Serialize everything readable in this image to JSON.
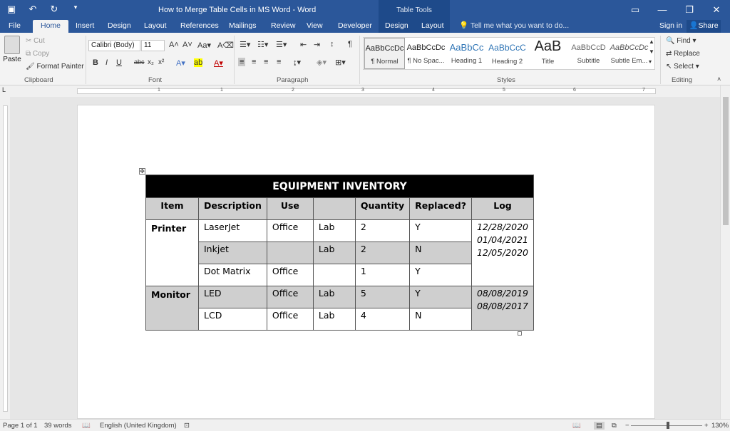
{
  "titlebar": {
    "doc_title": "How to Merge Table Cells in MS Word - Word",
    "context_group": "Table Tools"
  },
  "tabs": [
    "File",
    "Home",
    "Insert",
    "Design",
    "Layout",
    "References",
    "Mailings",
    "Review",
    "View",
    "Developer",
    "Design",
    "Layout"
  ],
  "tell_me": "Tell me what you want to do...",
  "sign_in": "Sign in",
  "share": "Share",
  "clipboard": {
    "paste": "Paste",
    "cut": "Cut",
    "copy": "Copy",
    "format_painter": "Format Painter",
    "label": "Clipboard"
  },
  "font": {
    "name": "Calibri (Body)",
    "size": "11",
    "label": "Font"
  },
  "paragraph": {
    "label": "Paragraph"
  },
  "styles": {
    "label": "Styles",
    "items": [
      {
        "sample": "AaBbCcDc",
        "name": "¶ Normal"
      },
      {
        "sample": "AaBbCcDc",
        "name": "¶ No Spac..."
      },
      {
        "sample": "AaBbCc",
        "name": "Heading 1"
      },
      {
        "sample": "AaBbCcC",
        "name": "Heading 2"
      },
      {
        "sample": "AaB",
        "name": "Title"
      },
      {
        "sample": "AaBbCcD",
        "name": "Subtitle"
      },
      {
        "sample": "AaBbCcDc",
        "name": "Subtle Em..."
      }
    ]
  },
  "editing": {
    "find": "Find",
    "replace": "Replace",
    "select": "Select",
    "label": "Editing"
  },
  "ruler_numbers": [
    "1",
    "1",
    "2",
    "3",
    "4",
    "5",
    "6",
    "7"
  ],
  "table": {
    "title": "EQUIPMENT INVENTORY",
    "headers": [
      "Item",
      "Description",
      "Use",
      "",
      "Quantity",
      "Replaced?",
      "Log"
    ],
    "printer": {
      "item": "Printer",
      "rows": [
        {
          "desc": "LaserJet",
          "use": "Office",
          "loc": "Lab",
          "qty": "2",
          "rep": "Y"
        },
        {
          "desc": "Inkjet",
          "use": "",
          "loc": "Lab",
          "qty": "2",
          "rep": "N"
        },
        {
          "desc": "Dot Matrix",
          "use": "Office",
          "loc": "",
          "qty": "1",
          "rep": "Y"
        }
      ],
      "log": [
        "12/28/2020",
        "01/04/2021",
        "12/05/2020"
      ]
    },
    "monitor": {
      "item": "Monitor",
      "rows": [
        {
          "desc": "LED",
          "use": "Office",
          "loc": "Lab",
          "qty": "5",
          "rep": "Y"
        },
        {
          "desc": "LCD",
          "use": "Office",
          "loc": "Lab",
          "qty": "4",
          "rep": "N"
        }
      ],
      "log": [
        "08/08/2019",
        "08/08/2017"
      ]
    }
  },
  "status": {
    "page": "Page 1 of 1",
    "words": "39 words",
    "language": "English (United Kingdom)",
    "zoom": "130%"
  }
}
